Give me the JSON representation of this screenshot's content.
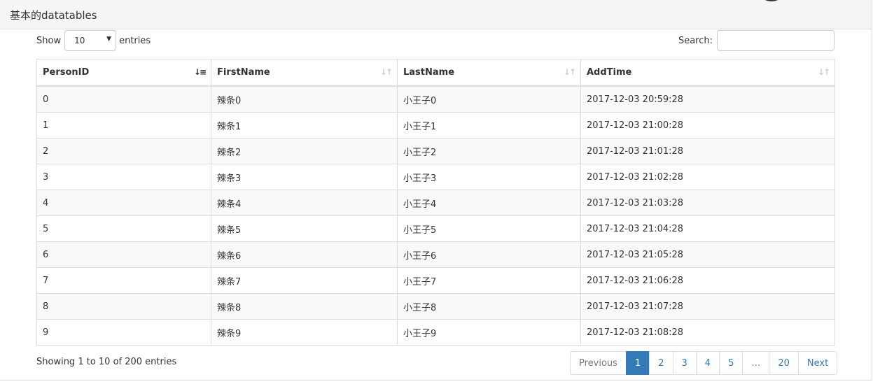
{
  "panel": {
    "title": "基本的datatables"
  },
  "length": {
    "label_before": "Show",
    "value": "10",
    "label_after": "entries"
  },
  "search": {
    "label": "Search:",
    "value": ""
  },
  "table": {
    "columns": [
      {
        "label": "PersonID",
        "sort": "ascending"
      },
      {
        "label": "FirstName",
        "sort": "none"
      },
      {
        "label": "LastName",
        "sort": "none"
      },
      {
        "label": "AddTime",
        "sort": "none"
      }
    ],
    "rows": [
      [
        "0",
        "辣条0",
        "小王子0",
        "2017-12-03 20:59:28"
      ],
      [
        "1",
        "辣条1",
        "小王子1",
        "2017-12-03 21:00:28"
      ],
      [
        "2",
        "辣条2",
        "小王子2",
        "2017-12-03 21:01:28"
      ],
      [
        "3",
        "辣条3",
        "小王子3",
        "2017-12-03 21:02:28"
      ],
      [
        "4",
        "辣条4",
        "小王子4",
        "2017-12-03 21:03:28"
      ],
      [
        "5",
        "辣条5",
        "小王子5",
        "2017-12-03 21:04:28"
      ],
      [
        "6",
        "辣条6",
        "小王子6",
        "2017-12-03 21:05:28"
      ],
      [
        "7",
        "辣条7",
        "小王子7",
        "2017-12-03 21:06:28"
      ],
      [
        "8",
        "辣条8",
        "小王子8",
        "2017-12-03 21:07:28"
      ],
      [
        "9",
        "辣条9",
        "小王子9",
        "2017-12-03 21:08:28"
      ]
    ]
  },
  "info": "Showing 1 to 10 of 200 entries",
  "pagination": {
    "previous": "Previous",
    "pages": [
      "1",
      "2",
      "3",
      "4",
      "5"
    ],
    "ellipsis": "…",
    "last": "20",
    "next": "Next",
    "current": "1"
  },
  "colors": {
    "accent": "#337ab7",
    "border": "#dddddd",
    "stripe": "#f9f9f9",
    "heading_bg": "#f5f5f5"
  }
}
